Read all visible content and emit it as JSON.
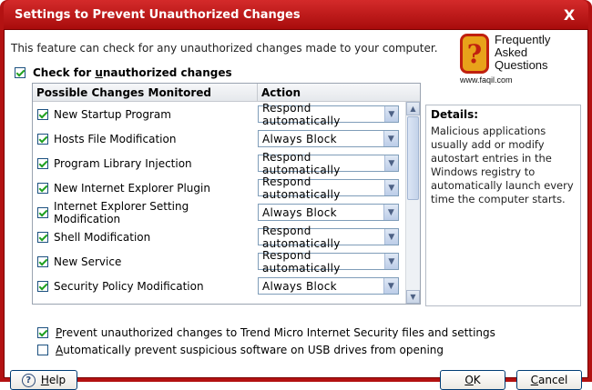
{
  "window": {
    "title": "Settings to Prevent Unauthorized Changes",
    "close_label": "X"
  },
  "intro_text": "This feature can check for any unauthorized changes made to your computer.",
  "main_check": {
    "label_pre": "Check for ",
    "label_underline": "u",
    "label_post": "nauthorized changes",
    "checked": true
  },
  "watermark": {
    "lines": [
      "Frequently",
      "Asked",
      "Questions"
    ],
    "url": "www.faqil.com"
  },
  "table": {
    "headers": [
      "Possible Changes Monitored",
      "Action"
    ],
    "rows": [
      {
        "name": "New Startup Program",
        "action": "Respond automatically",
        "checked": true
      },
      {
        "name": "Hosts File Modification",
        "action": "Always Block",
        "checked": true
      },
      {
        "name": "Program Library Injection",
        "action": "Respond automatically",
        "checked": true
      },
      {
        "name": "New Internet Explorer Plugin",
        "action": "Respond automatically",
        "checked": true
      },
      {
        "name": "Internet Explorer Setting Modification",
        "action": "Always Block",
        "checked": true
      },
      {
        "name": "Shell Modification",
        "action": "Respond automatically",
        "checked": true
      },
      {
        "name": "New Service",
        "action": "Respond automatically",
        "checked": true
      },
      {
        "name": "Security Policy Modification",
        "action": "Always Block",
        "checked": true
      }
    ]
  },
  "details": {
    "title": "Details:",
    "body": "Malicious applications usually add or modify autostart entries in the Windows registry to automatically launch every time the computer starts."
  },
  "options": [
    {
      "label_underline": "P",
      "label_post": "revent unauthorized changes to Trend Micro Internet Security files and settings",
      "checked": true
    },
    {
      "label_underline": "A",
      "label_post": "utomatically prevent suspicious software on USB drives from opening",
      "checked": false
    }
  ],
  "buttons": {
    "help_underline": "H",
    "help_post": "elp",
    "ok_underline": "O",
    "ok_post": "K",
    "cancel_underline": "C",
    "cancel_post": "ancel"
  },
  "colors": {
    "titlebar": "#b31212",
    "check_mark": "#21a121"
  }
}
